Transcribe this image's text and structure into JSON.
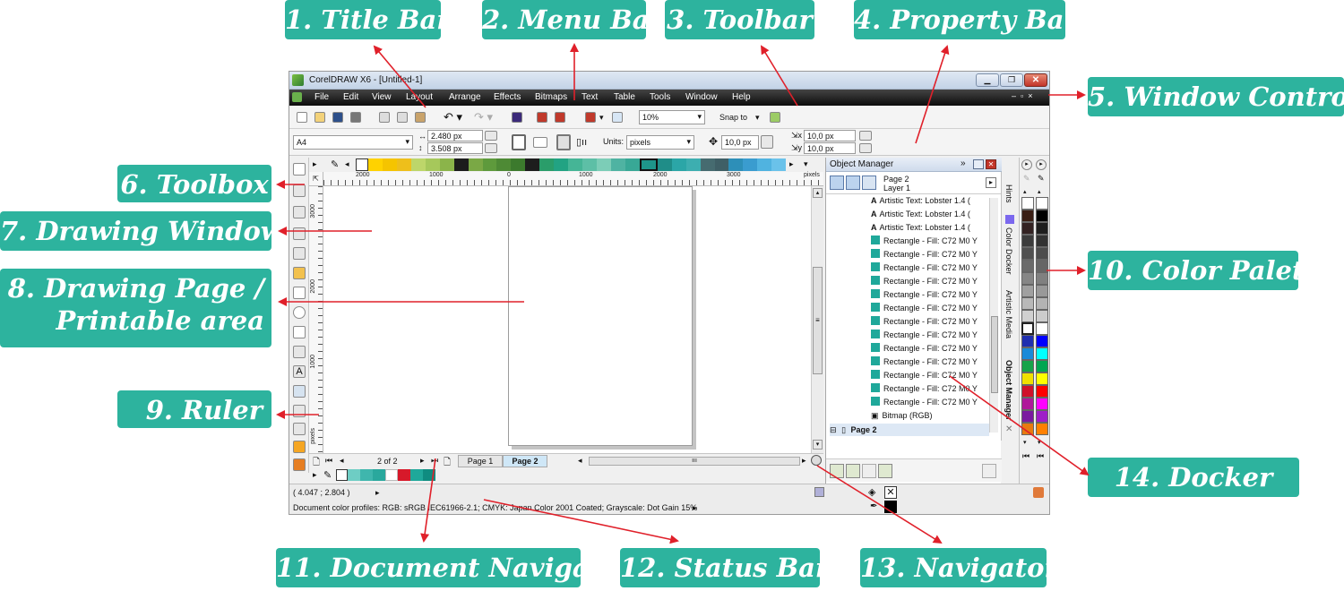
{
  "callouts": {
    "title_bar": "1. Title Bar",
    "menu_bar": "2. Menu Bar",
    "toolbar": "3. Toolbar",
    "property_bar": "4. Property Bar",
    "window_control": "5. Window Control",
    "toolbox": "6. Toolbox",
    "drawing_window": "7. Drawing Window",
    "drawing_page_l1": "8. Drawing Page /",
    "drawing_page_l2": "Printable area",
    "ruler": "9. Ruler",
    "color_palette": "10. Color Palette",
    "document_navigator": "11. Document Navigator",
    "status_bar": "12. Status Bar",
    "navigator": "13. Navigator",
    "docker": "14. Docker"
  },
  "colors": {
    "callout_bg": "#2db39e",
    "arrow": "#e0202a",
    "teal_swatch": "#1fa89a"
  },
  "app": {
    "window_title": "CorelDRAW X6 - [Untitled-1]",
    "window_controls": [
      "minimize-icon",
      "restore-icon",
      "close-icon"
    ],
    "menu": [
      "File",
      "Edit",
      "View",
      "Layout",
      "Arrange",
      "Effects",
      "Bitmaps",
      "Text",
      "Table",
      "Tools",
      "Window",
      "Help"
    ],
    "toolbar": {
      "zoom": "10%",
      "snap_to": "Snap to"
    },
    "property_bar": {
      "page_size": "A4",
      "width": "2.480 px",
      "height": "3.508 px",
      "units_label": "Units:",
      "units": "pixels",
      "nudge": "10,0 px",
      "dup_x": "10,0 px",
      "dup_y": "10,0 px"
    },
    "ruler": {
      "h_ticks": [
        "2000",
        "1000",
        "0",
        "1000",
        "2000",
        "3000"
      ],
      "h_unit": "pixels",
      "v_ticks": [
        "3000",
        "2000",
        "1000"
      ],
      "v_unit": "pixels"
    },
    "doc_navigator": {
      "position": "2 of 2",
      "tabs": [
        "Page 1",
        "Page 2"
      ]
    },
    "status": {
      "coords": "( 4.047 ; 2.804 )",
      "profiles": "Document color profiles: RGB: sRGB IEC61966-2.1; CMYK: Japan Color 2001 Coated; Grayscale: Dot Gain 15%"
    },
    "docker": {
      "title": "Object Manager",
      "page": "Page 2",
      "layer": "Layer 1",
      "items": [
        "Artistic Text: Lobster 1.4 (",
        "Artistic Text: Lobster 1.4 (",
        "Artistic Text: Lobster 1.4 (",
        "Rectangle - Fill: C72 M0 Y",
        "Rectangle - Fill: C72 M0 Y",
        "Rectangle - Fill: C72 M0 Y",
        "Rectangle - Fill: C72 M0 Y",
        "Rectangle - Fill: C72 M0 Y",
        "Rectangle - Fill: C72 M0 Y",
        "Rectangle - Fill: C72 M0 Y",
        "Rectangle - Fill: C72 M0 Y",
        "Rectangle - Fill: C72 M0 Y",
        "Rectangle - Fill: C72 M0 Y",
        "Rectangle - Fill: C72 M0 Y",
        "Rectangle - Fill: C72 M0 Y",
        "Rectangle - Fill: C72 M0 Y",
        "Bitmap (RGB)"
      ],
      "footer_page": "Page 2",
      "side_tabs": [
        "Hints",
        "Color Docker",
        "Artistic Media",
        "Object Manager"
      ]
    }
  }
}
